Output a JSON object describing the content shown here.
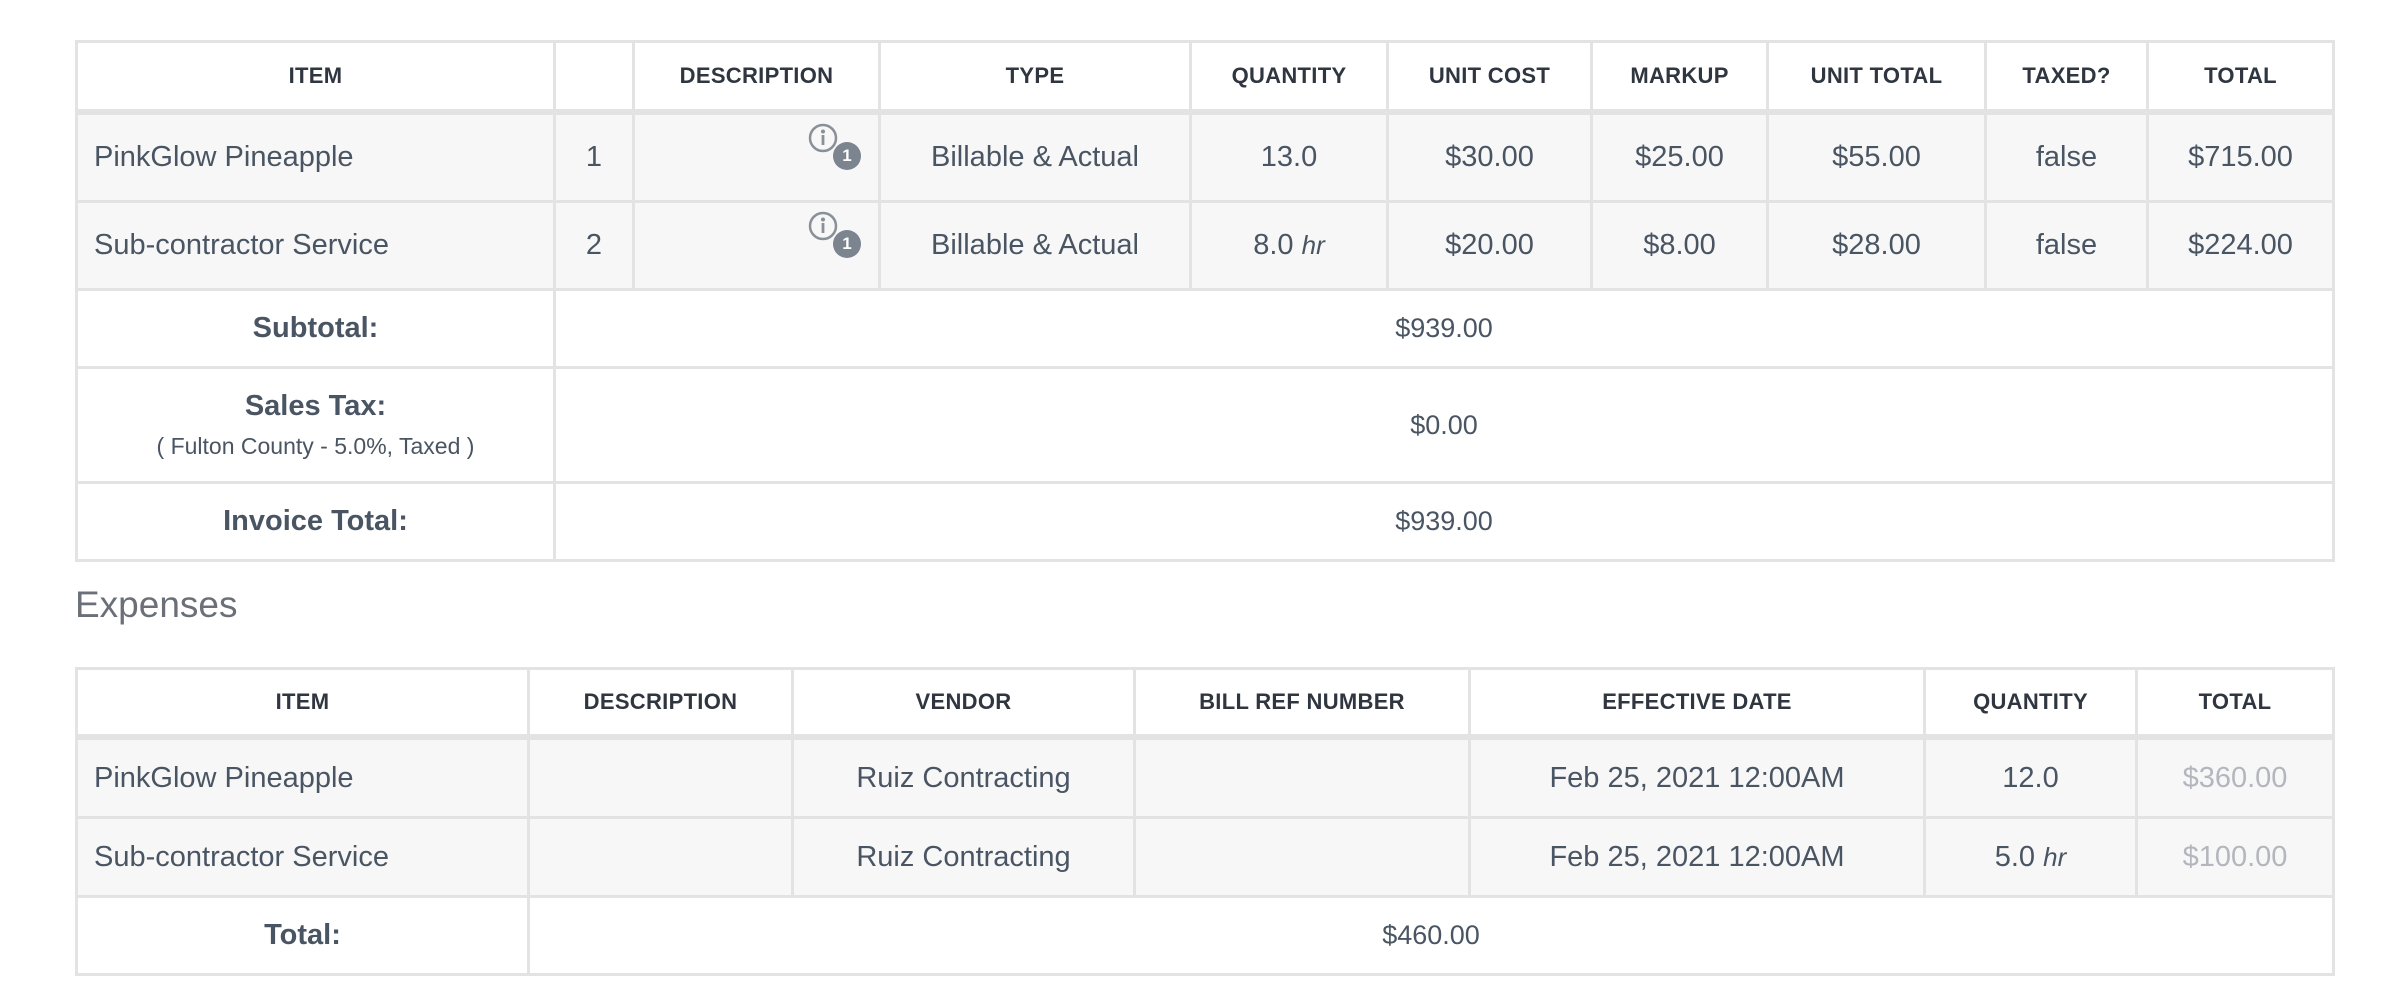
{
  "items_table": {
    "headers": [
      "ITEM",
      "",
      "DESCRIPTION",
      "TYPE",
      "QUANTITY",
      "UNIT COST",
      "MARKUP",
      "UNIT TOTAL",
      "TAXED?",
      "TOTAL"
    ],
    "rows": [
      {
        "item": "PinkGlow Pineapple",
        "num": "1",
        "badge": "1",
        "type": "Billable & Actual",
        "qty": "13.0",
        "qty_unit": "",
        "unit_cost": "$30.00",
        "markup": "$25.00",
        "unit_total": "$55.00",
        "taxed": "false",
        "total": "$715.00"
      },
      {
        "item": "Sub-contractor Service",
        "num": "2",
        "badge": "1",
        "type": "Billable & Actual",
        "qty": "8.0",
        "qty_unit": "hr",
        "unit_cost": "$20.00",
        "markup": "$8.00",
        "unit_total": "$28.00",
        "taxed": "false",
        "total": "$224.00"
      }
    ],
    "subtotal_label": "Subtotal:",
    "subtotal_value": "$939.00",
    "sales_tax_label": "Sales Tax:",
    "sales_tax_note": "( Fulton County - 5.0%, Taxed )",
    "sales_tax_value": "$0.00",
    "invoice_total_label": "Invoice Total:",
    "invoice_total_value": "$939.00"
  },
  "expenses": {
    "title": "Expenses",
    "headers": [
      "ITEM",
      "DESCRIPTION",
      "VENDOR",
      "BILL REF NUMBER",
      "EFFECTIVE DATE",
      "QUANTITY",
      "TOTAL"
    ],
    "rows": [
      {
        "item": "PinkGlow Pineapple",
        "description": "",
        "vendor": "Ruiz Contracting",
        "bill_ref": "",
        "date": "Feb 25, 2021 12:00AM",
        "qty": "12.0",
        "qty_unit": "",
        "total": "$360.00"
      },
      {
        "item": "Sub-contractor Service",
        "description": "",
        "vendor": "Ruiz Contracting",
        "bill_ref": "",
        "date": "Feb 25, 2021 12:00AM",
        "qty": "5.0",
        "qty_unit": "hr",
        "total": "$100.00"
      }
    ],
    "total_label": "Total:",
    "total_value": "$460.00"
  },
  "icons": {
    "description_info": "info-icon"
  },
  "colors": {
    "border": "#e3e3e3",
    "row_bg": "#f7f7f7",
    "text": "#4a5563",
    "muted": "#b3b7bd",
    "badge": "#7c8490"
  }
}
